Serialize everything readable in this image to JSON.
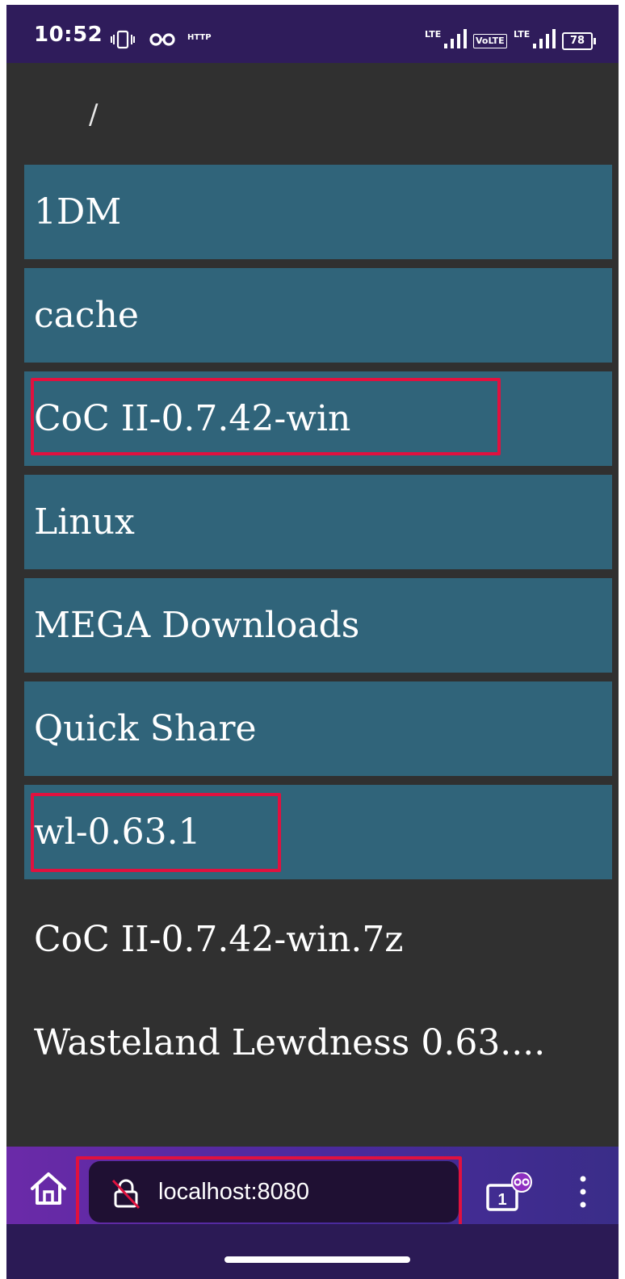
{
  "status_bar": {
    "time": "10:52",
    "vibrate_icon": "vibrate-icon",
    "incognito_icon": "incognito-icon",
    "http_label": "HTTP",
    "lte1": "LTE",
    "volte": "VoLTE",
    "lte2": "LTE",
    "battery": "78"
  },
  "breadcrumb": "/",
  "directories": [
    {
      "name": "1DM"
    },
    {
      "name": "cache"
    },
    {
      "name": "CoC II-0.7.42-win"
    },
    {
      "name": "Linux"
    },
    {
      "name": "MEGA Downloads"
    },
    {
      "name": "Quick Share"
    },
    {
      "name": "wl-0.63.1"
    }
  ],
  "files": [
    {
      "name": "CoC II-0.7.42-win.7z"
    },
    {
      "name": "Wasteland Lewdness 0.63...."
    }
  ],
  "browser_bar": {
    "home_icon": "home-icon",
    "lock_icon": "insecure-lock-icon",
    "url": "localhost:8080",
    "tab_count": "1",
    "menu_icon": "more-vert-icon"
  },
  "colors": {
    "status_bar": "#2f1c5b",
    "background": "#303030",
    "dir_item": "#30647a",
    "highlight": "#e0113f",
    "url_bar": "#1f1033"
  }
}
